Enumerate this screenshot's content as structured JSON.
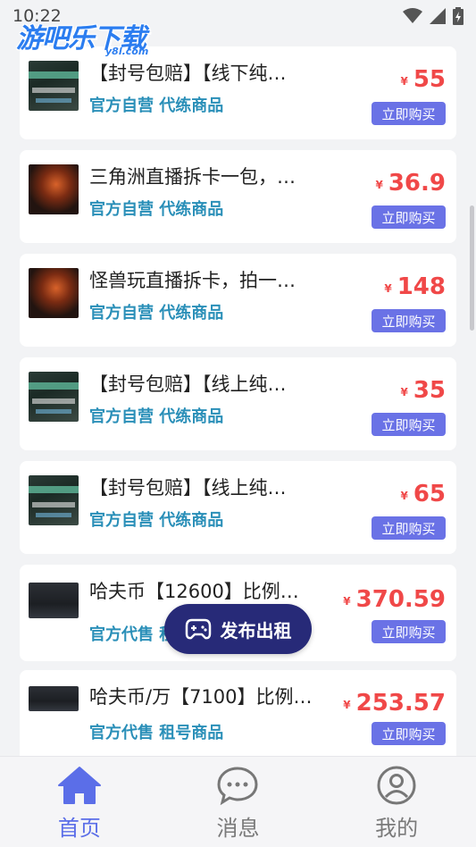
{
  "status_bar": {
    "time": "10:22"
  },
  "watermark": {
    "name": "游吧乐下载",
    "domain": "y8l.com"
  },
  "products": [
    {
      "title": "【封号包赔】【线下纯…",
      "tags": "官方自营 代练商品",
      "price": "55",
      "currency": "¥",
      "buy_label": "立即购买",
      "thumb": "green"
    },
    {
      "title": "三角洲直播拆卡一包，…",
      "tags": "官方自营 代练商品",
      "price": "36.9",
      "currency": "¥",
      "buy_label": "立即购买",
      "thumb": "fire"
    },
    {
      "title": "怪兽玩直播拆卡，拍一…",
      "tags": "官方自营 代练商品",
      "price": "148",
      "currency": "¥",
      "buy_label": "立即购买",
      "thumb": "fire"
    },
    {
      "title": "【封号包赔】【线上纯…",
      "tags": "官方自营 代练商品",
      "price": "35",
      "currency": "¥",
      "buy_label": "立即购买",
      "thumb": "green"
    },
    {
      "title": "【封号包赔】【线上纯…",
      "tags": "官方自营 代练商品",
      "price": "65",
      "currency": "¥",
      "buy_label": "立即购买",
      "thumb": "green"
    },
    {
      "title": "哈夫币【12600】比例…",
      "tags": "官方代售 租号商品",
      "price": "370.59",
      "currency": "¥",
      "buy_label": "立即购买",
      "thumb": "dark"
    },
    {
      "title": "哈夫币/万【7100】比例…",
      "tags": "官方代售 租号商品",
      "price": "253.57",
      "currency": "¥",
      "buy_label": "立即购买",
      "thumb": "dark"
    }
  ],
  "publish_button": {
    "label": "发布出租",
    "icon": "gamepad-icon"
  },
  "tabbar": {
    "items": [
      {
        "label": "首页",
        "icon": "home-icon",
        "active": true
      },
      {
        "label": "消息",
        "icon": "chat-icon",
        "active": false
      },
      {
        "label": "我的",
        "icon": "user-icon",
        "active": false
      }
    ]
  },
  "colors": {
    "price": "#f04848",
    "buy_button": "#6a72e6",
    "tag": "#2a8fb8",
    "publish": "#272a78",
    "tab_active": "#5b6ee8"
  }
}
